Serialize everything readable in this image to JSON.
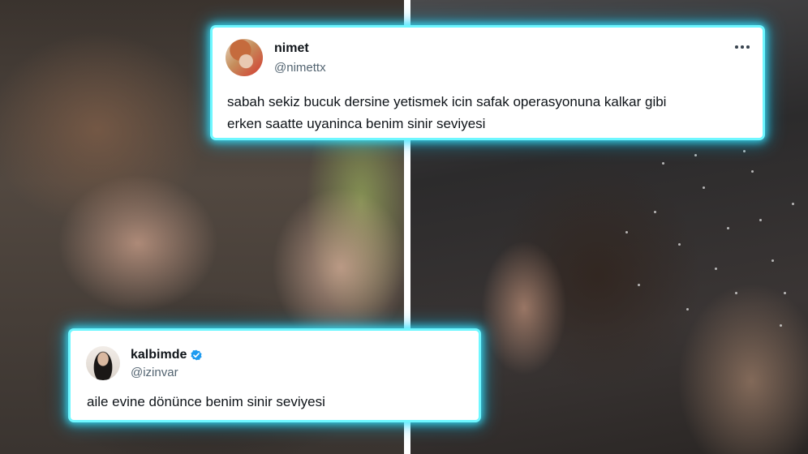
{
  "tweets": [
    {
      "name": "nimet",
      "handle": "@nimettx",
      "text": "sabah sekiz bucuk dersine yetismek icin safak operasyonuna kalkar gibi\nerken saatte uyaninca benim sinir seviyesi",
      "more_icon": "more-horizontal-icon",
      "verified": false
    },
    {
      "name": "kalbimde",
      "handle": "@izinvar",
      "text": "aile evine dönünce benim sinir seviyesi",
      "verified_icon": "verified-badge-icon",
      "verified": true
    }
  ],
  "colors": {
    "glow": "#6ff7ff",
    "verified_blue": "#1d9bf0",
    "text": "#0f1419",
    "handle": "#536471"
  }
}
